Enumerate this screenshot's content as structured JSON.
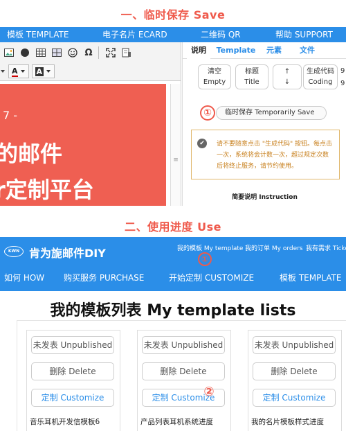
{
  "sections": {
    "save_title": "一、临时保存 Save",
    "use_title": "二、使用进度 Use"
  },
  "topnav": {
    "items": [
      "模板 TEMPLATE",
      "电子名片 ECARD",
      "二维码 QR",
      "帮助 SUPPORT"
    ]
  },
  "editor": {
    "toolbar_icons": [
      "image-icon",
      "compass-icon",
      "table-icon",
      "grid-icon",
      "smiley-icon",
      "omega-icon",
      "maximize-icon",
      "preview-icon"
    ],
    "omega": "Ω",
    "font_color_label": "A",
    "bg_color_label": "A",
    "canvas_small": "7 -",
    "canvas_line1": "的邮件",
    "canvas_line2": "r定制平台"
  },
  "panel": {
    "tabs": [
      "说明",
      "Template",
      "元素",
      "文件"
    ],
    "buttons": [
      {
        "zh": "清空",
        "en": "Empty"
      },
      {
        "zh": "标题",
        "en": "Title"
      },
      {
        "zh": "↑",
        "en": "↓"
      },
      {
        "zh": "生成代码",
        "en": "Coding"
      }
    ],
    "side_num_1": "9",
    "side_num_2": "9",
    "marker": "①",
    "save_button": "临时保存 Temporarily Save",
    "notice": "请不要随意点击 \"生成代码\" 按钮。每点击一次，系统将会计数一次，超过规定次数后将终止服务，请节约使用。",
    "instruction": "简要说明 Instruction"
  },
  "site": {
    "logo": "KWN",
    "brand": "肯为旎邮件DIY",
    "top_links": [
      "我的模板 My template",
      "我的订单 My orders",
      "我有需求 Ticke"
    ],
    "marker": "①",
    "main_nav": [
      "如何 HOW",
      "购买服务 PURCHASE",
      "开始定制 CUSTOMIZE",
      "模板 TEMPLATE"
    ]
  },
  "templates": {
    "title": "我的模板列表 My template lists",
    "unpublished": "未发表 Unpublished",
    "delete": "删除 Delete",
    "customize": "定制 Customize",
    "marker": "②",
    "cards": [
      {
        "name": "音乐耳机开发信模板6"
      },
      {
        "name": "产品列表耳机系统进度"
      },
      {
        "name": "我的名片模板样式进度"
      }
    ]
  },
  "colors": {
    "accent_blue": "#2b8ee8",
    "marker_red": "#ef5a4c",
    "canvas_red": "#ef5f52"
  }
}
